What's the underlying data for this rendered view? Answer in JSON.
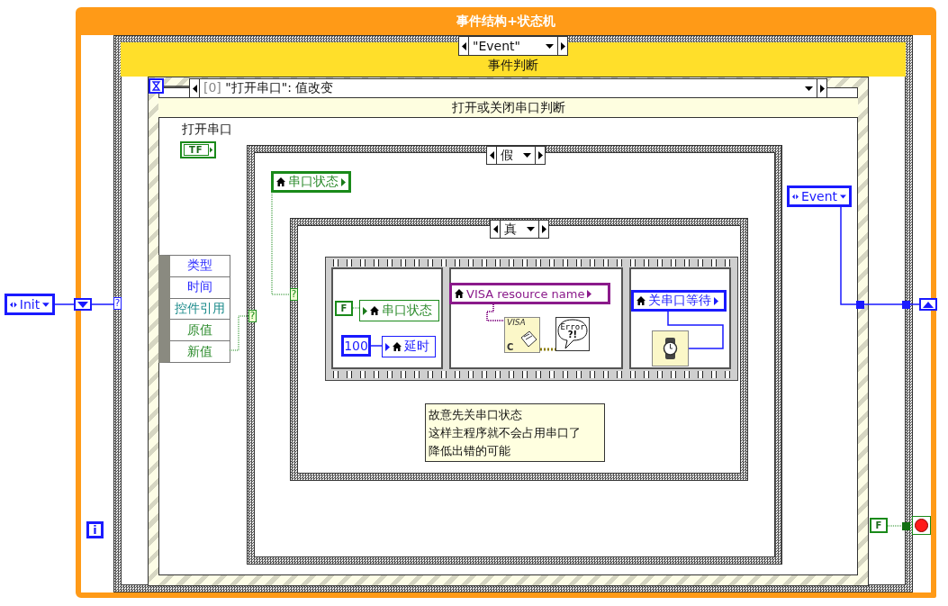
{
  "loop": {
    "title": "事件结构+状态机",
    "iteration": "i"
  },
  "init_state": "Init",
  "state_case": {
    "selector": "\"Event\"",
    "label": "事件判断",
    "selector_tunnel": "?"
  },
  "event_structure": {
    "index": "[0]",
    "event": "\"打开串口\": 值改变",
    "label": "打开或关闭串口判断",
    "control": {
      "label": "打开串口",
      "terminal": "TF"
    },
    "event_data": [
      {
        "label": "类型",
        "color": "#2b2bff"
      },
      {
        "label": "时间",
        "color": "#2b2bff"
      },
      {
        "label": "控件引用",
        "color": "#1a8a8a"
      },
      {
        "label": "原值",
        "color": "#2a8a2a"
      },
      {
        "label": "新值",
        "color": "#2a8a2a"
      }
    ],
    "outer_case": {
      "selector": "假",
      "selector_tunnel": "?",
      "read_local": "串口状态",
      "inner_case": {
        "selector": "真",
        "selector_tunnel": "?",
        "sequence": [
          {
            "bool_constant": "F",
            "locals": [
              "串口状态",
              "延时"
            ],
            "numeric_constant": "100"
          },
          {
            "read_local": "VISA resource name",
            "visa_icon": [
              "VISA",
              "C"
            ],
            "error_icon": [
              "Error",
              "?!"
            ]
          },
          {
            "read_local": "关串口等待"
          }
        ],
        "comment": [
          "故意先关串口状态",
          "这样主程序就不会占用串口了",
          "降低出错的可能"
        ]
      }
    },
    "next_state": "Event"
  },
  "stop": {
    "constant": "F"
  }
}
